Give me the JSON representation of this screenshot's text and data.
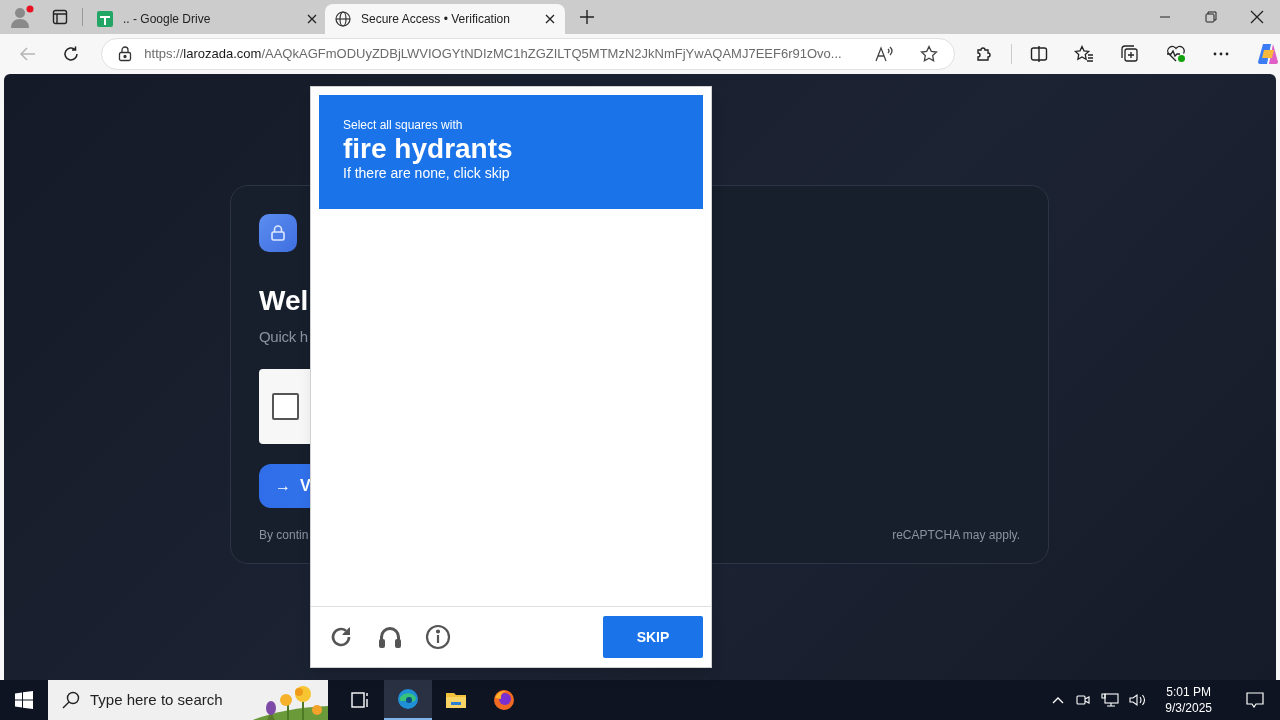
{
  "browser": {
    "tabs": [
      {
        "title": ".. - Google Drive",
        "selected": false,
        "kind": "sheets"
      },
      {
        "title": "Secure Access • Verification",
        "selected": true,
        "kind": "globe"
      }
    ],
    "back_disabled": true,
    "address": {
      "scheme": "https://",
      "host": "larozada.com",
      "path": "/AAQkAGFmODUyZDBjLWVIOGYtNDIzMC1hZGZILTQ5MTMzN2JkNmFjYwAQAMJ7EEF6r91Ovo..."
    }
  },
  "card": {
    "heading": "Wel",
    "subtitle": "Quick h",
    "checkbox_checked": false,
    "button_icon": "→",
    "button_label": "V",
    "footer_left": "By contin",
    "footer_right": "reCAPTCHA may apply."
  },
  "captcha": {
    "instruction": "Select all squares with",
    "target": "fire hydrants",
    "hint": "If there are none, click skip",
    "skip_label": "SKIP"
  },
  "taskbar": {
    "search_placeholder": "Type here to search",
    "apps": [
      {
        "kind": "taskview",
        "selected": false
      },
      {
        "kind": "edge",
        "selected": true
      },
      {
        "kind": "files",
        "selected": false
      },
      {
        "kind": "firefox",
        "selected": false
      }
    ],
    "time": "5:01 PM",
    "date": "9/3/2025"
  }
}
